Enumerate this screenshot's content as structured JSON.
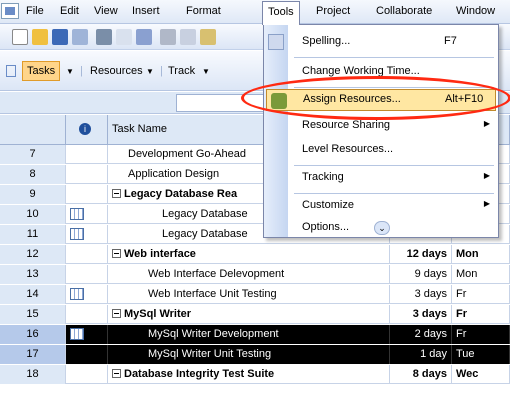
{
  "menubar": {
    "items": [
      "File",
      "Edit",
      "View",
      "Insert",
      "Format",
      "Tools",
      "Project",
      "Collaborate",
      "Window"
    ]
  },
  "toolbar2": {
    "tasks": "Tasks",
    "resources": "Resources",
    "track": "Track"
  },
  "grid": {
    "headers": {
      "name": "Task Name"
    },
    "rows": [
      {
        "id": "7",
        "name": "Development Go-Ahead",
        "dur": "",
        "start": ""
      },
      {
        "id": "8",
        "name": "Application Design",
        "dur": "",
        "start": ""
      },
      {
        "id": "9",
        "name": "Legacy Database Rea",
        "dur": "",
        "start": ""
      },
      {
        "id": "10",
        "name": "Legacy Database",
        "dur": "",
        "start": ""
      },
      {
        "id": "11",
        "name": "Legacy Database",
        "dur": "",
        "start": ""
      },
      {
        "id": "12",
        "name": "Web interface",
        "dur": "12 days",
        "start": "Mon"
      },
      {
        "id": "13",
        "name": "Web Interface Delevopment",
        "dur": "9 days",
        "start": "Mon"
      },
      {
        "id": "14",
        "name": "Web Interface Unit Testing",
        "dur": "3 days",
        "start": "Fr"
      },
      {
        "id": "15",
        "name": "MySql Writer",
        "dur": "3 days",
        "start": "Fr"
      },
      {
        "id": "16",
        "name": "MySql Writer Development",
        "dur": "2 days",
        "start": "Fr"
      },
      {
        "id": "17",
        "name": "MySql Writer Unit Testing",
        "dur": "1 day",
        "start": "Tue"
      },
      {
        "id": "18",
        "name": "Database Integrity Test Suite",
        "dur": "8 days",
        "start": "Wec"
      }
    ]
  },
  "tools_menu": {
    "spelling": {
      "label": "Spelling...",
      "shortcut": "F7"
    },
    "change_working_time": {
      "label": "Change Working Time..."
    },
    "assign_resources": {
      "label": "Assign Resources...",
      "shortcut": "Alt+F10"
    },
    "resource_sharing": {
      "label": "Resource Sharing"
    },
    "level_resources": {
      "label": "Level Resources..."
    },
    "tracking": {
      "label": "Tracking"
    },
    "customize": {
      "label": "Customize"
    },
    "options": {
      "label": "Options..."
    }
  },
  "colors": {
    "highlight": "#ffe7a2",
    "annotation": "#ff2a12",
    "selected_row": "#000000",
    "tasks_button": "#ffd58a"
  }
}
